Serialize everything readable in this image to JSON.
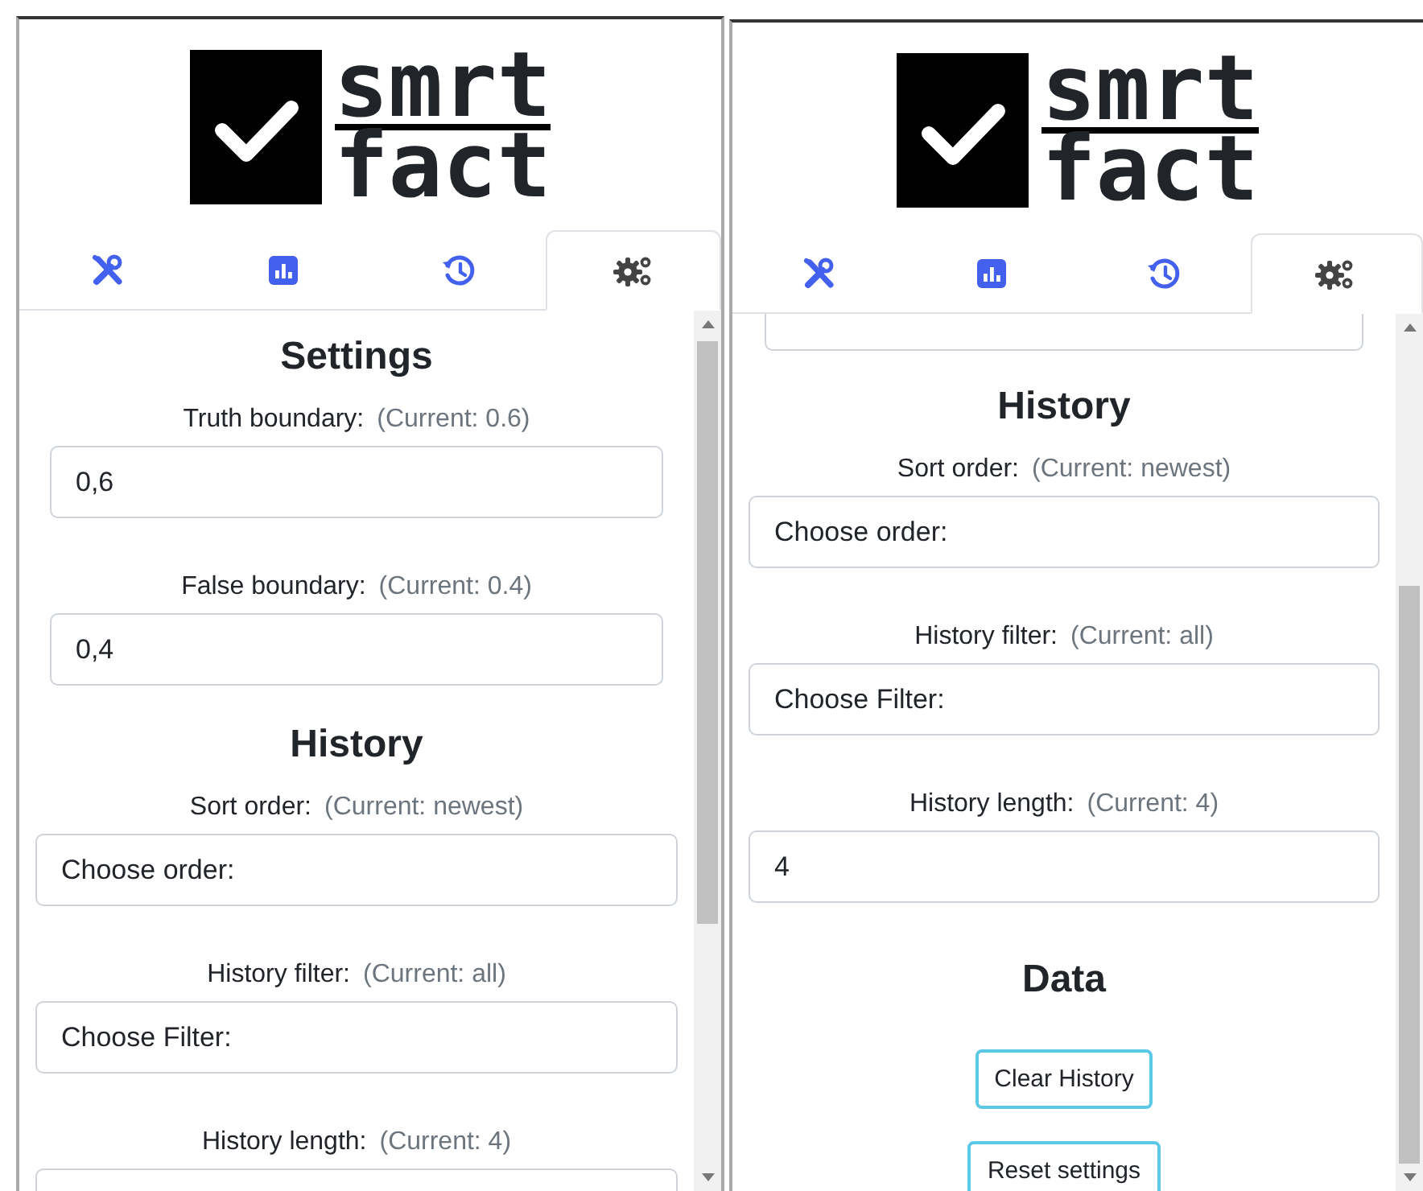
{
  "panels": [
    {
      "logo": {
        "line_1": "smrt",
        "line_2": "fact"
      },
      "tabs": [
        {
          "selected": false
        },
        {
          "selected": false
        },
        {
          "selected": false
        },
        {
          "selected": true
        }
      ],
      "content": [
        {
          "kind": "heading",
          "text": "Settings"
        },
        {
          "kind": "decimal",
          "label": "Truth boundary:",
          "current": "(Current: 0.6)",
          "value": "0,6"
        },
        {
          "kind": "decimal",
          "label": "False boundary:",
          "current": "(Current: 0.4)",
          "value": "0,4"
        },
        {
          "kind": "heading",
          "text": "History"
        },
        {
          "kind": "select",
          "label": "Sort order:",
          "current": "(Current: newest)",
          "placeholder": "Choose order:"
        },
        {
          "kind": "select",
          "label": "History filter:",
          "current": "(Current: all)",
          "placeholder": "Choose Filter:"
        },
        {
          "kind": "number",
          "label": "History length:",
          "current": "(Current: 4)"
        }
      ]
    },
    {
      "logo": {
        "line_1": "smrt",
        "line_2": "fact"
      },
      "tabs": [
        {
          "selected": false
        },
        {
          "selected": false
        },
        {
          "selected": false
        },
        {
          "selected": true
        }
      ],
      "content": [
        {
          "kind": "cut"
        },
        {
          "kind": "heading",
          "text": "History"
        },
        {
          "kind": "select",
          "label": "Sort order:",
          "current": "(Current: newest)",
          "placeholder": "Choose order:"
        },
        {
          "kind": "select",
          "label": "History filter:",
          "current": "(Current: all)",
          "placeholder": "Choose Filter:"
        },
        {
          "kind": "number",
          "label": "History length:",
          "current": "(Current: 4)",
          "value": "4"
        },
        {
          "kind": "heading",
          "text": "Data"
        },
        {
          "kind": "button",
          "text": "Clear History"
        },
        {
          "kind": "button",
          "text": "Reset settings"
        }
      ]
    }
  ]
}
